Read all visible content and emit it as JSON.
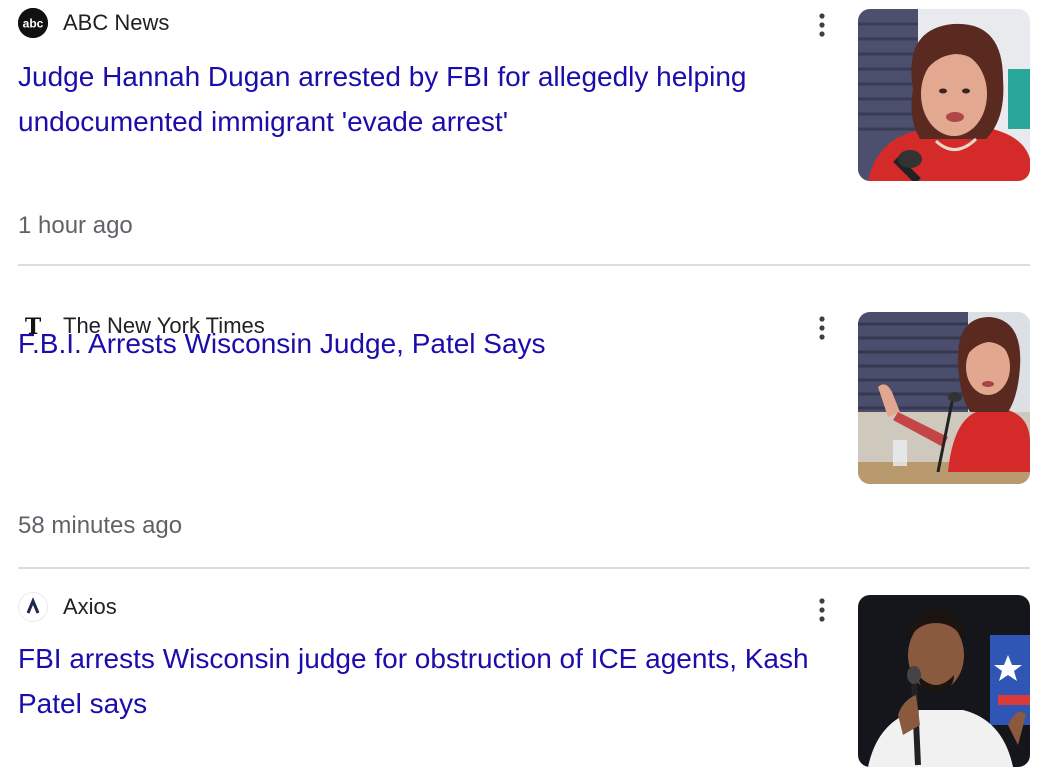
{
  "articles": [
    {
      "source": "ABC News",
      "source_icon": "abc-logo-icon",
      "headline": "Judge Hannah Dugan arrested by FBI for allegedly helping undocumented immigrant 'evade arrest'",
      "time": "1 hour ago",
      "thumbnail": "woman-speaking-at-microphone-photo"
    },
    {
      "source": "The New York Times",
      "source_icon": "nyt-logo-icon",
      "headline": "F.B.I. Arrests Wisconsin Judge, Patel Says",
      "time": "58 minutes ago",
      "thumbnail": "woman-gesturing-at-microphone-photo"
    },
    {
      "source": "Axios",
      "source_icon": "axios-logo-icon",
      "headline": "FBI arrests Wisconsin judge for obstruction of ICE agents, Kash Patel says",
      "thumbnail": "man-speaking-at-microphone-photo"
    }
  ],
  "colors": {
    "headline": "#1a0dab",
    "source": "#202124",
    "time": "#5f6368",
    "divider": "#dadce0"
  }
}
